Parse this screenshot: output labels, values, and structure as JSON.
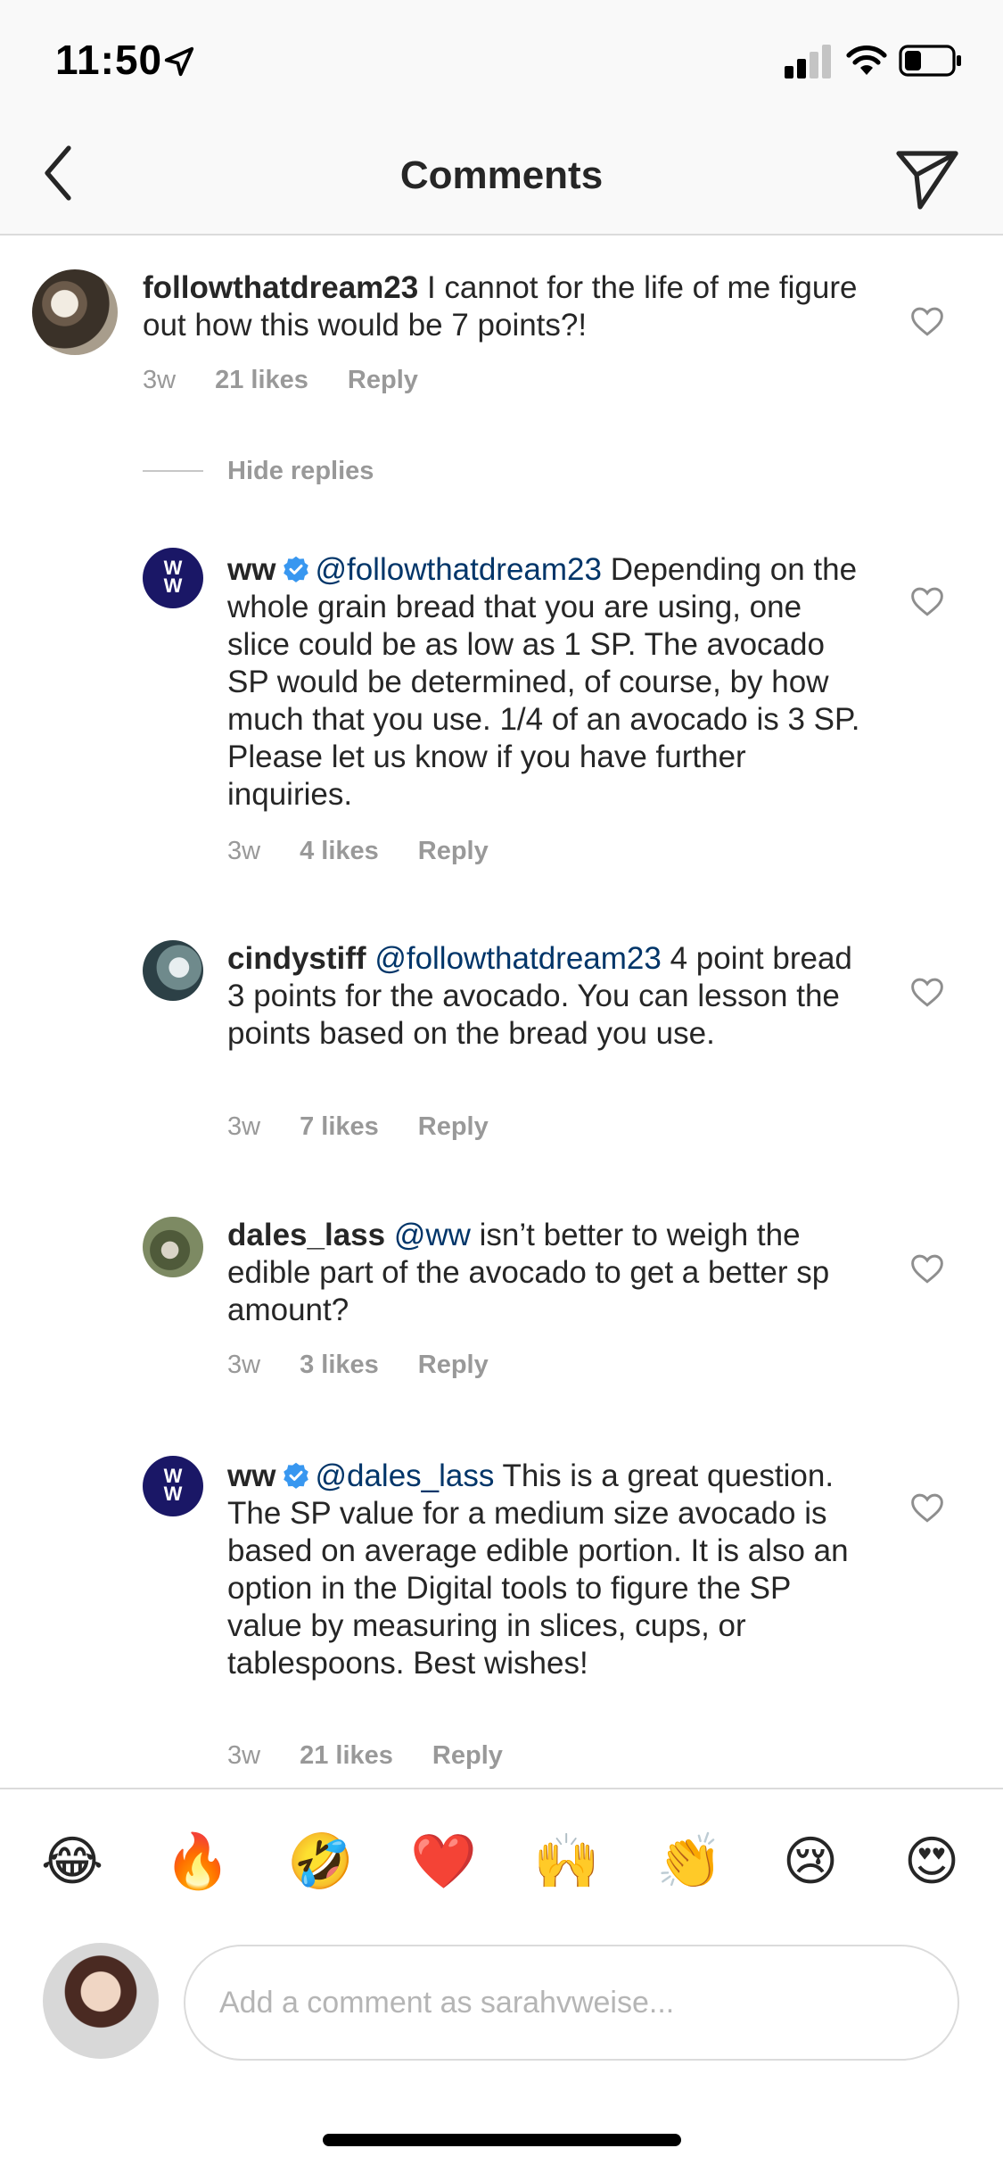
{
  "status": {
    "time": "11:50"
  },
  "nav": {
    "title": "Comments"
  },
  "comments": [
    {
      "username": "followthatdream23",
      "text": "I cannot for the life of me figure out how this would be 7 points?!",
      "time": "3w",
      "likes": "21 likes",
      "reply": "Reply"
    }
  ],
  "hide_replies": "Hide replies",
  "replies": [
    {
      "username": "ww",
      "verified": true,
      "mention": "@followthatdream23",
      "text": " Depending on the whole grain bread that you are using, one slice could be as low as 1 SP. The avocado SP would be determined, of course, by how much that you use. 1/4 of an avocado is 3 SP. Please let us know if you have further inquiries.",
      "time": "3w",
      "likes": "4 likes",
      "reply": "Reply"
    },
    {
      "username": "cindystiff",
      "verified": false,
      "mention": "@followthatdream23",
      "text": " 4 point bread 3 points for the avocado. You can lesson the points based on the bread you use.",
      "time": "3w",
      "likes": "7 likes",
      "reply": "Reply"
    },
    {
      "username": "dales_lass",
      "verified": false,
      "mention": "@ww",
      "text": " isn’t better to weigh the edible part of the avocado to get a better sp amount?",
      "time": "3w",
      "likes": "3 likes",
      "reply": "Reply"
    },
    {
      "username": "ww",
      "verified": true,
      "mention": "@dales_lass",
      "text": " This is a great question. The SP value for a medium size avocado is based on average edible portion. It is also an option in the Digital tools to figure the SP value by measuring in slices, cups, or tablespoons. Best wishes!",
      "time": "3w",
      "likes": "21 likes",
      "reply": "Reply"
    }
  ],
  "emoji_bar": [
    "😂",
    "🔥",
    "🤣",
    "❤️",
    "🙌",
    "👏",
    "😢",
    "😍"
  ],
  "input": {
    "placeholder": "Add a comment as sarahvweise..."
  },
  "colors": {
    "mention": "#003569",
    "meta": "#999999",
    "verified": "#3897f0",
    "ww_brand": "#1a1766"
  }
}
